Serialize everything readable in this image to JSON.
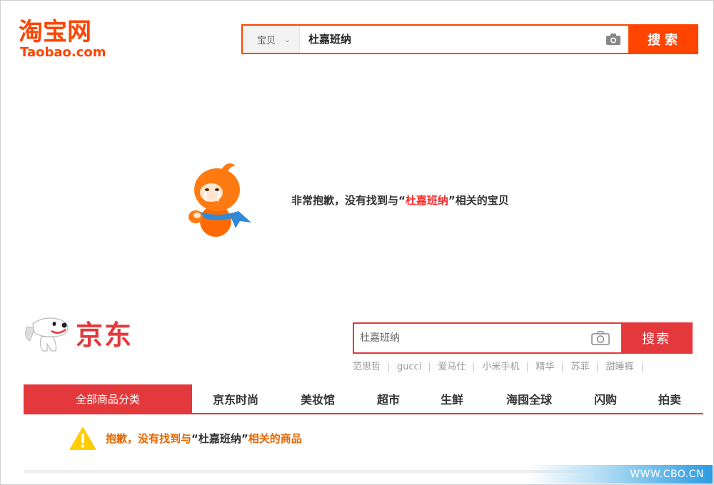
{
  "taobao": {
    "logo_cn": "淘宝网",
    "logo_en": "Taobao.com",
    "search": {
      "scope": "宝贝",
      "query": "杜嘉班纳",
      "button": "搜索"
    },
    "empty_message": {
      "before": "非常抱歉，没有找到与“",
      "keyword": "杜嘉班纳",
      "after": "”相关的宝贝"
    },
    "brand_color": "#ff4400"
  },
  "jd": {
    "logo_text": "京东",
    "search": {
      "query": "杜嘉班纳",
      "button": "搜索"
    },
    "hot_words": [
      "范思哲",
      "gucci",
      "爱马仕",
      "小米手机",
      "精华",
      "苏菲",
      "甜睡裤"
    ],
    "nav": {
      "all_categories": "全部商品分类",
      "items": [
        "京东时尚",
        "美妆馆",
        "超市",
        "生鲜",
        "海囤全球",
        "闪购",
        "拍卖"
      ]
    },
    "notice": {
      "before": "抱歉，没有找到与",
      "keyword": "“杜嘉班纳”",
      "after": "相关的商品"
    },
    "brand_color": "#e4393c"
  },
  "watermark": "WWW.CBO.CN"
}
